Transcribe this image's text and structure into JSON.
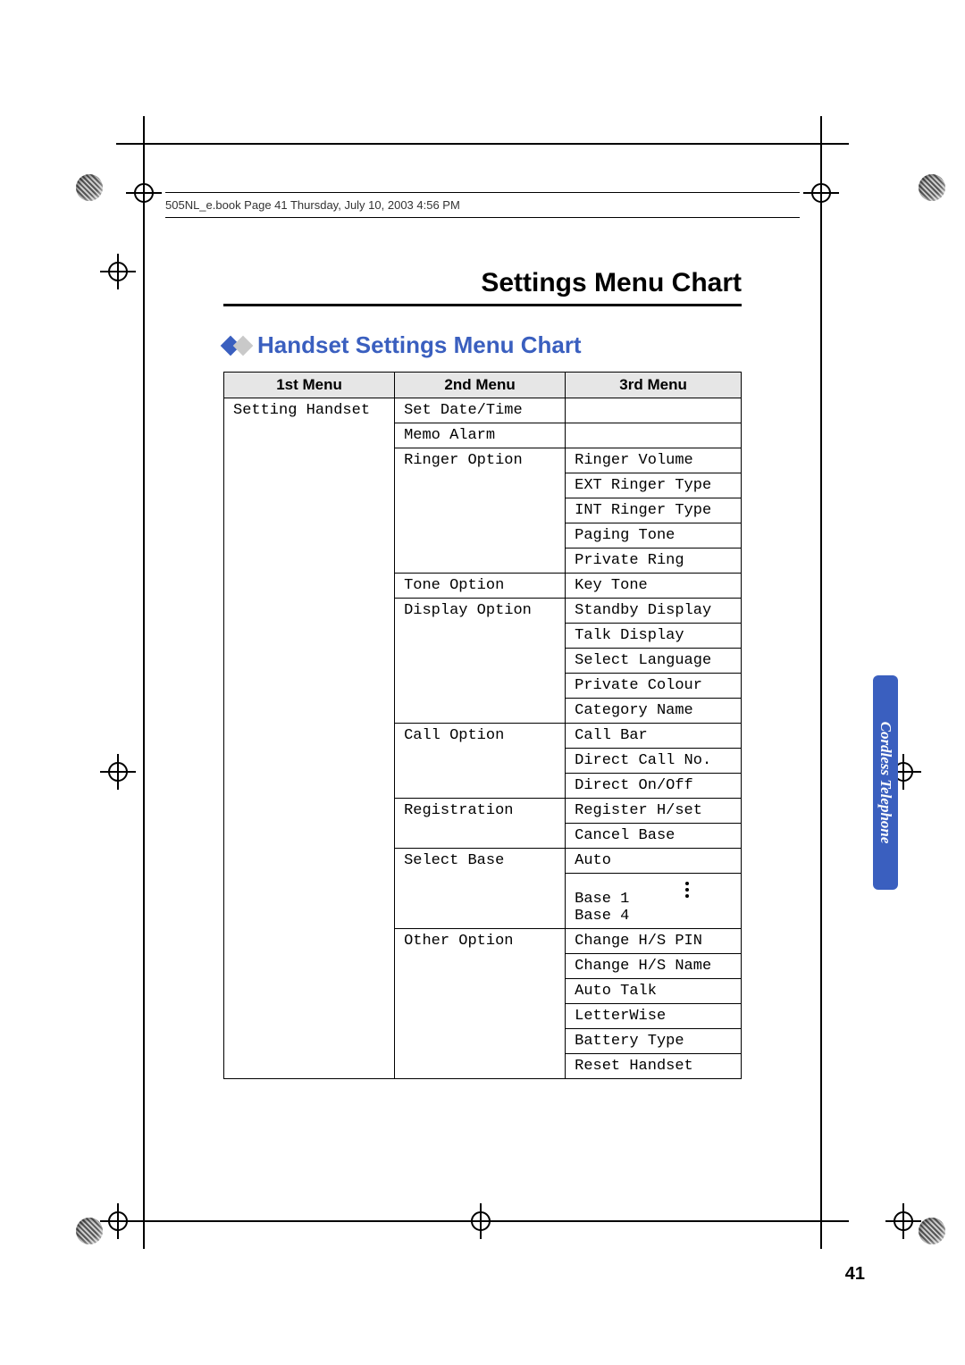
{
  "file_header": "505NL_e.book  Page 41  Thursday, July 10, 2003  4:56 PM",
  "title": "Settings Menu Chart",
  "subtitle": "Handset Settings Menu Chart",
  "side_tab": "Cordless Telephone",
  "page_number": "41",
  "table": {
    "headers": {
      "c1": "1st Menu",
      "c2": "2nd Menu",
      "c3": "3rd Menu"
    },
    "col1": "Setting Handset",
    "rows": [
      {
        "m2": "Set Date/Time",
        "m3": [
          ""
        ]
      },
      {
        "m2": "Memo Alarm",
        "m3": [
          ""
        ]
      },
      {
        "m2": "Ringer Option",
        "m3": [
          "Ringer Volume",
          "EXT Ringer Type",
          "INT Ringer Type",
          "Paging Tone",
          "Private Ring"
        ]
      },
      {
        "m2": "Tone Option",
        "m3": [
          "Key Tone"
        ]
      },
      {
        "m2": "Display Option",
        "m3": [
          "Standby Display",
          "Talk Display",
          "Select Language",
          "Private Colour",
          "Category Name"
        ]
      },
      {
        "m2": "Call Option",
        "m3": [
          "Call Bar",
          "Direct Call No.",
          "Direct On/Off"
        ]
      },
      {
        "m2": "Registration",
        "m3": [
          "Register H/set",
          "Cancel Base"
        ]
      },
      {
        "m2": "Select Base",
        "m3": [
          "Auto",
          "Base 1 … Base 4"
        ]
      },
      {
        "m2": "Other Option",
        "m3": [
          "Change H/S PIN",
          "Change H/S Name",
          "Auto Talk",
          "LetterWise",
          "Battery Type",
          "Reset Handset"
        ]
      }
    ],
    "select_base": {
      "first": "Auto",
      "range_top": "Base 1",
      "range_bottom": "Base 4"
    }
  }
}
